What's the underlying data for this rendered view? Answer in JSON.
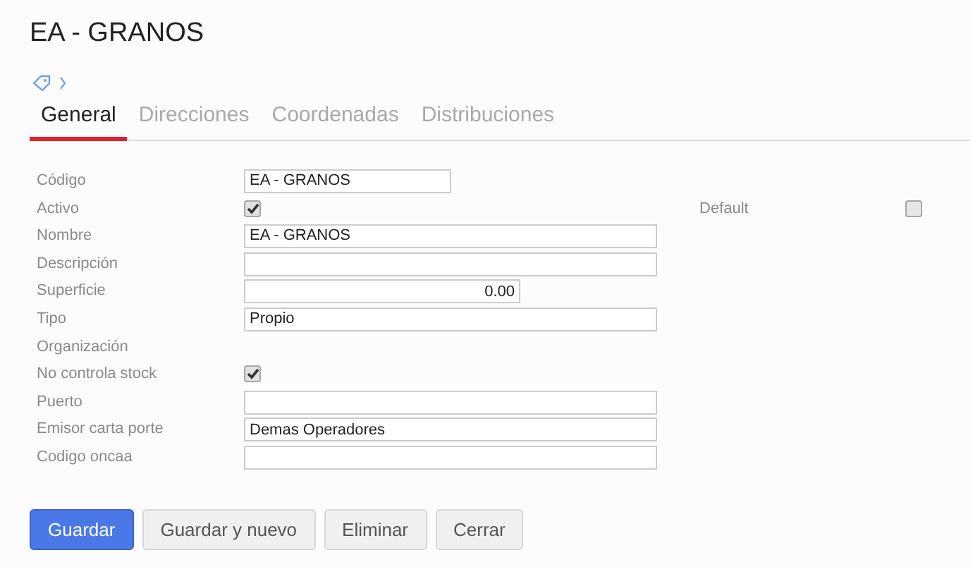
{
  "title": "EA - GRANOS",
  "tabs": [
    {
      "label": "General",
      "selected": true
    },
    {
      "label": "Direcciones",
      "selected": false
    },
    {
      "label": "Coordenadas",
      "selected": false
    },
    {
      "label": "Distribuciones",
      "selected": false
    }
  ],
  "fields": [
    {
      "label": "Código",
      "kind": "code",
      "value": "EA - GRANOS"
    },
    {
      "label": "Activo",
      "kind": "checkbox",
      "checked": true,
      "aside": {
        "label": "Default",
        "checked": false
      }
    },
    {
      "label": "Nombre",
      "kind": "text",
      "value": "EA - GRANOS"
    },
    {
      "label": "Descripción",
      "kind": "text"
    },
    {
      "label": "Superficie",
      "kind": "number",
      "value": "0.00"
    },
    {
      "label": "Tipo",
      "kind": "text",
      "value": "Propio"
    },
    {
      "label": "Organización",
      "kind": "none"
    },
    {
      "label": "No controla stock",
      "kind": "checkbox",
      "checked": true
    },
    {
      "label": "Puerto",
      "kind": "text"
    },
    {
      "label": "Emisor carta porte",
      "kind": "text",
      "value": "Demas Operadores"
    },
    {
      "label": "Codigo oncaa",
      "kind": "text"
    }
  ],
  "buttons": [
    {
      "label": "Guardar",
      "kind": "primary"
    },
    {
      "label": "Guardar y nuevo",
      "kind": "default"
    },
    {
      "label": "Eliminar",
      "kind": "default"
    },
    {
      "label": "Cerrar",
      "kind": "default"
    }
  ]
}
